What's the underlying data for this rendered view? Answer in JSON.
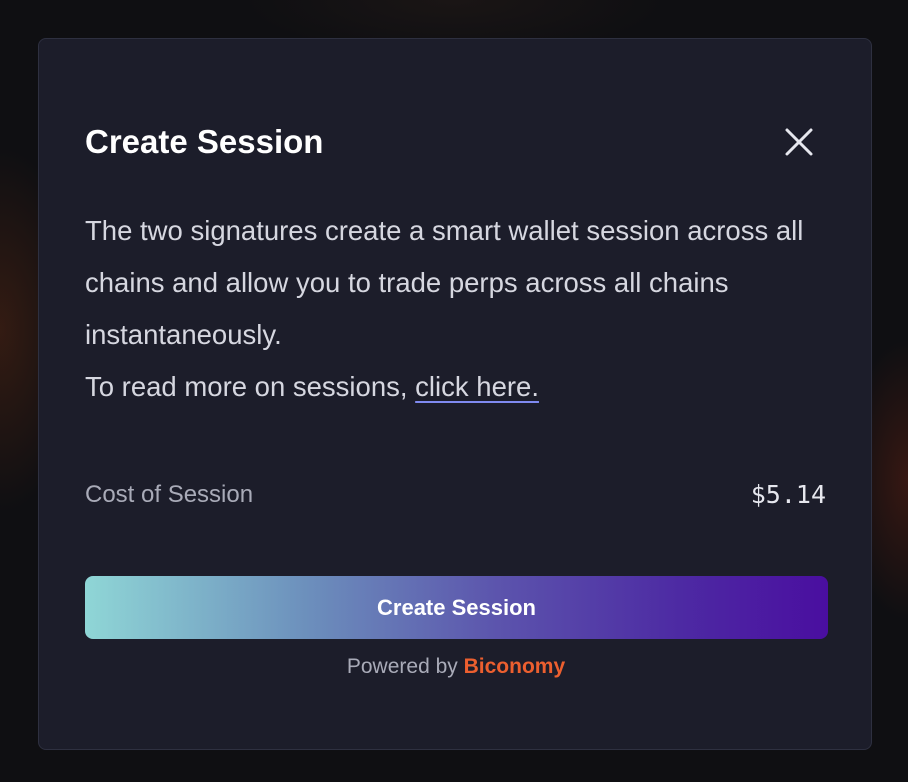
{
  "modal": {
    "title": "Create Session",
    "close_icon": "close-icon",
    "description": {
      "line1": "The two signatures create a smart wallet session across all chains and allow you to trade perps across all chains instantaneously.",
      "line2_prefix": "To read more on sessions, ",
      "link_text": "click here."
    },
    "cost": {
      "label": "Cost of Session",
      "value": "$5.14"
    },
    "create_button_label": "Create Session",
    "footer": {
      "powered_prefix": "Powered by ",
      "brand": "Biconomy"
    }
  },
  "colors": {
    "modal_bg": "#1c1d2a",
    "brand": "#ec5f2f",
    "button_gradient_start": "#8fd6d6",
    "button_gradient_end": "#4a0ea0"
  }
}
